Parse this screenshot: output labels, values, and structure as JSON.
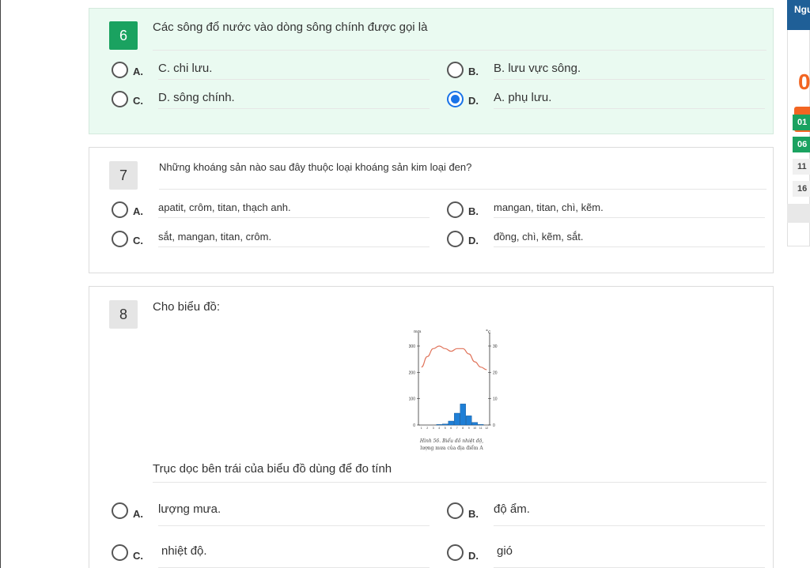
{
  "questions": [
    {
      "number": "6",
      "text": "Các sông đổ nước vào dòng sông chính được gọi là",
      "options": [
        {
          "letter": "A.",
          "text": "C. chi lưu.",
          "checked": false
        },
        {
          "letter": "B.",
          "text": "B. lưu vực sông.",
          "checked": false
        },
        {
          "letter": "C.",
          "text": "D. sông chính.",
          "checked": false
        },
        {
          "letter": "D.",
          "text": "A. phụ lưu.",
          "checked": true
        }
      ]
    },
    {
      "number": "7",
      "text": "Những khoáng sản nào sau đây thuộc loại khoáng sản kim loại đen?",
      "options": [
        {
          "letter": "A.",
          "text": "apatit, crôm, titan, thạch anh.",
          "checked": false
        },
        {
          "letter": "B.",
          "text": "mangan, titan, chì, kẽm.",
          "checked": false
        },
        {
          "letter": "C.",
          "text": "sắt, mangan, titan, crôm.",
          "checked": false
        },
        {
          "letter": "D.",
          "text": "đồng, chì, kẽm, sắt.",
          "checked": false
        }
      ]
    },
    {
      "number": "8",
      "text": "Cho biểu đồ:",
      "subtext": "Trục dọc bên trái của biểu đồ dùng để đo tính",
      "figure": {
        "left_unit": "mm",
        "right_unit": "°c",
        "left_ticks": [
          "300",
          "200",
          "100",
          "0"
        ],
        "right_ticks": [
          "30",
          "20",
          "10",
          "0"
        ],
        "months": [
          "1",
          "2",
          "3",
          "4",
          "5",
          "6",
          "7",
          "8",
          "9",
          "10",
          "11",
          "12"
        ],
        "temperature_c": [
          22,
          26,
          29,
          30,
          29,
          28,
          29,
          29,
          27,
          24,
          22,
          21
        ],
        "rainfall_mm": [
          0,
          0,
          0,
          2,
          4,
          15,
          45,
          80,
          35,
          10,
          2,
          0
        ],
        "caption_line1": "Hình 56. Biểu đồ nhiệt độ,",
        "caption_line2": "lượng mưa của địa điểm A",
        "line_color": "#e0735a",
        "bar_color": "#1f7fd6"
      },
      "options": [
        {
          "letter": "A.",
          "text": "lượng mưa.",
          "checked": false
        },
        {
          "letter": "B.",
          "text": "độ ẩm.",
          "checked": false
        },
        {
          "letter": "C.",
          "text": "nhiệt độ.",
          "checked": false
        },
        {
          "letter": "D.",
          "text": "gió",
          "checked": false
        }
      ]
    }
  ],
  "sidebar": {
    "header": "Ngu",
    "counter": "0",
    "question_links": [
      {
        "label": "01",
        "state": "answered"
      },
      {
        "label": "06",
        "state": "answered"
      },
      {
        "label": "11",
        "state": "pending"
      },
      {
        "label": "16",
        "state": "pending"
      }
    ]
  },
  "colors": {
    "accent_green": "#1aa260",
    "active_bg": "#eafaf1",
    "radio_checked": "#1a73e8",
    "sidebar_blue": "#1f5f97",
    "orange": "#f26522"
  }
}
